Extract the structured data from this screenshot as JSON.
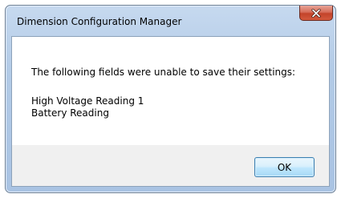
{
  "window": {
    "title": "Dimension Configuration Manager",
    "close_icon": "close-x-icon"
  },
  "dialog": {
    "message": "The following fields were unable to save their settings:",
    "fields": [
      "High Voltage Reading 1",
      "Battery Reading"
    ],
    "ok_label": "OK"
  },
  "colors": {
    "frame": "#b3cbe7",
    "close_button": "#c3432a",
    "footer": "#f0f0f0",
    "ok_border": "#3c7fb1"
  }
}
